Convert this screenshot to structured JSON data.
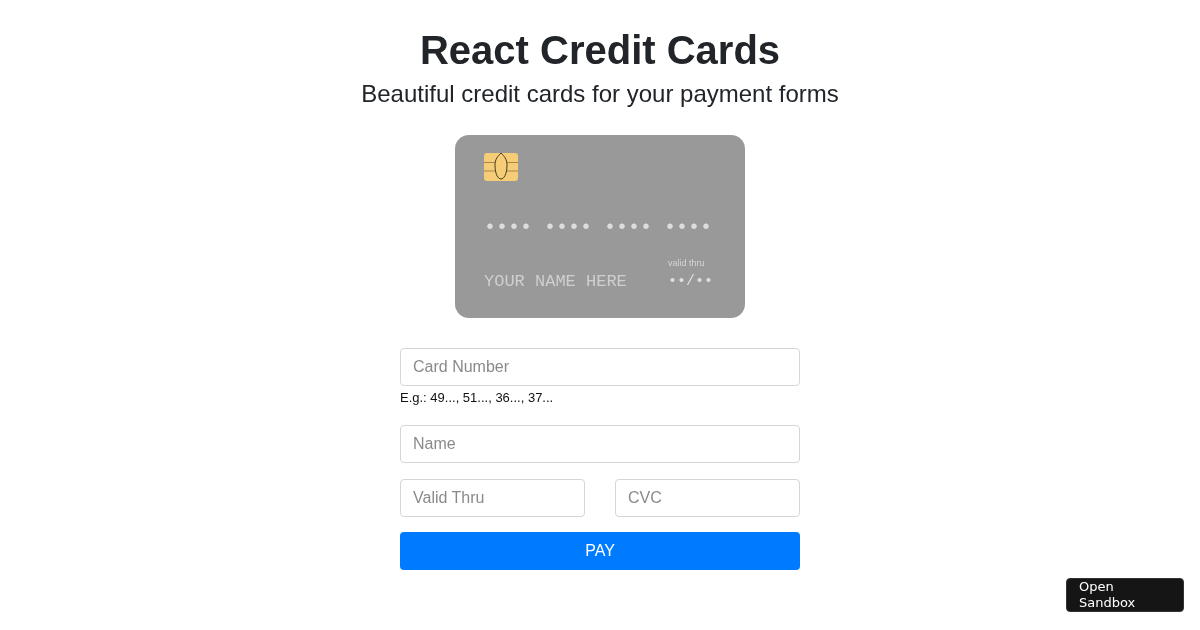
{
  "header": {
    "title": "React Credit Cards",
    "subtitle": "Beautiful credit cards for your payment forms"
  },
  "credit_card": {
    "number": "•••• •••• •••• ••••",
    "name": "YOUR NAME HERE",
    "expiry_label": "valid thru",
    "expiry": "••/••"
  },
  "form": {
    "rows": [
      {
        "fields": [
          {
            "placeholder": "Card Number",
            "hint": "E.g.: 49..., 51..., 36..., 37..."
          }
        ]
      },
      {
        "fields": [
          {
            "placeholder": "Name"
          }
        ]
      },
      {
        "fields": [
          {
            "placeholder": "Valid Thru"
          },
          {
            "placeholder": "CVC"
          }
        ]
      }
    ],
    "submit": "PAY"
  },
  "sandbox_button": "Open Sandbox"
}
